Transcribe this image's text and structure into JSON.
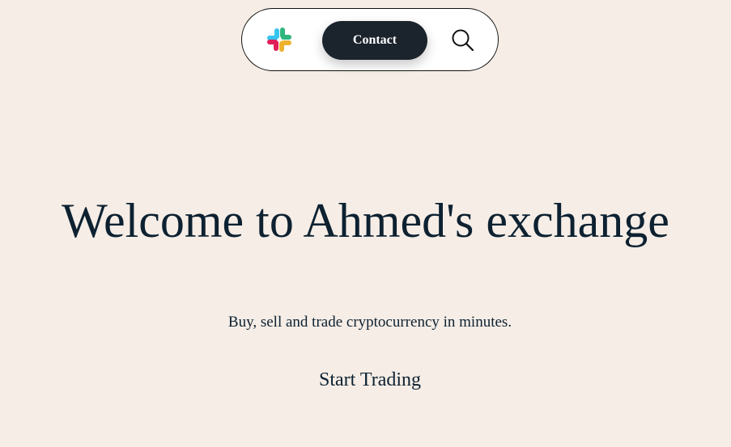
{
  "nav": {
    "logo_icon": "slack-logo-icon",
    "contact_label": "Contact",
    "search_icon": "search-icon"
  },
  "hero": {
    "title": "Welcome to Ahmed's exchange",
    "subtitle": "Buy, sell and trade cryptocurrency in minutes.",
    "cta_label": "Start Trading"
  },
  "colors": {
    "background": "#f5ede6",
    "navbar_bg": "#ffffff",
    "button_bg": "#1b232d",
    "text": "#0d2131",
    "logo_blue": "#36c5f0",
    "logo_green": "#2eb67d",
    "logo_yellow": "#ecb22e",
    "logo_red": "#e01e5a"
  }
}
